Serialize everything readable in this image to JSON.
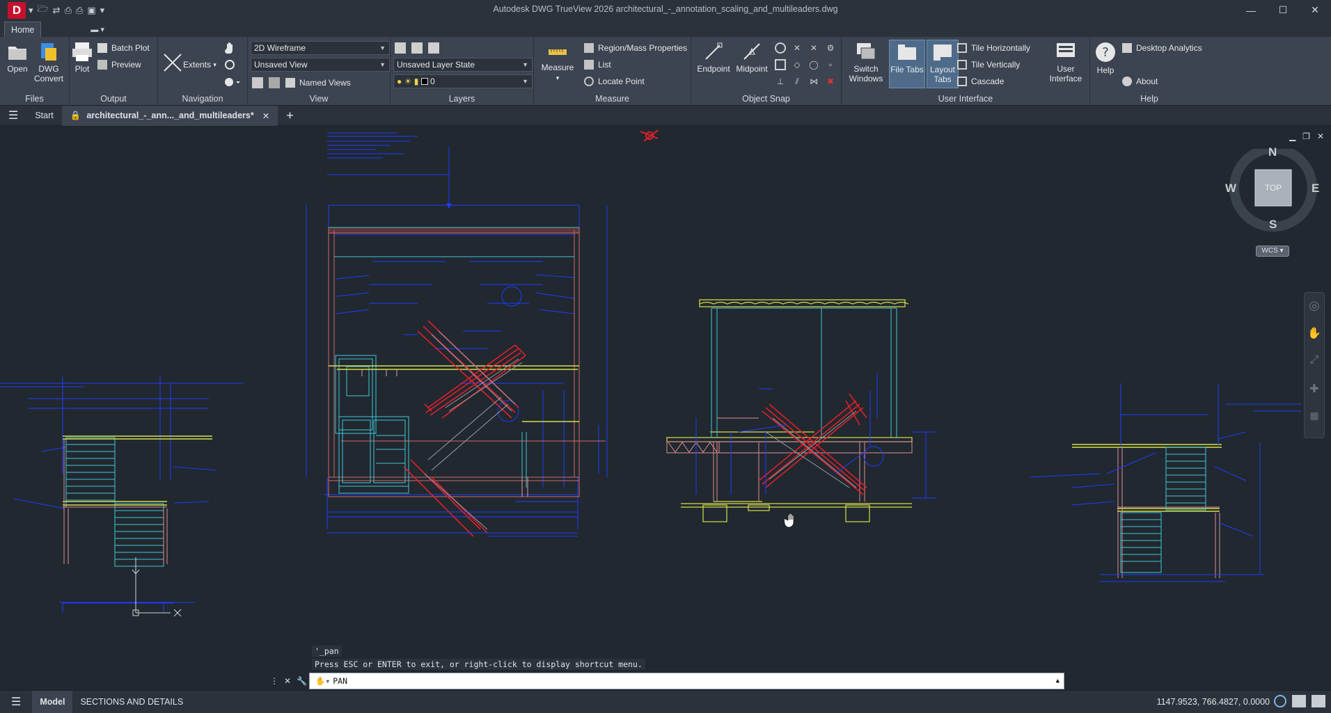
{
  "window": {
    "app_letter": "D",
    "title": "Autodesk DWG TrueView 2026    architectural_-_annotation_scaling_and_multileaders.dwg"
  },
  "ribbon": {
    "tab_home": "Home",
    "panels": {
      "files": {
        "title": "Files",
        "open": "Open",
        "dwg_convert_1": "DWG",
        "dwg_convert_2": "Convert"
      },
      "output": {
        "title": "Output",
        "plot": "Plot",
        "batch_plot": "Batch Plot",
        "preview": "Preview"
      },
      "navigation": {
        "title": "Navigation",
        "extents": "Extents"
      },
      "view": {
        "title": "View",
        "visual_style": "2D Wireframe",
        "saved_view": "Unsaved View",
        "named_views": "Named Views"
      },
      "layers": {
        "title": "Layers",
        "layer_state": "Unsaved Layer State",
        "current_layer": "0"
      },
      "measure": {
        "title": "Measure",
        "measure": "Measure",
        "region_mass": "Region/Mass Properties",
        "list": "List",
        "locate_point": "Locate Point"
      },
      "object_snap": {
        "title": "Object Snap",
        "endpoint": "Endpoint",
        "midpoint": "Midpoint"
      },
      "user_interface": {
        "title": "User Interface",
        "switch_windows_1": "Switch",
        "switch_windows_2": "Windows",
        "file_tabs_1": "File Tabs",
        "layout_tabs_1": "Layout",
        "layout_tabs_2": "Tabs",
        "tile_h": "Tile Horizontally",
        "tile_v": "Tile Vertically",
        "cascade": "Cascade",
        "user_interface_1": "User",
        "user_interface_2": "Interface"
      },
      "help": {
        "title": "Help",
        "help": "Help",
        "desktop_analytics": "Desktop Analytics",
        "about": "About"
      }
    }
  },
  "file_tabs": {
    "start": "Start",
    "current": "architectural_-_ann..._and_multileaders*"
  },
  "viewcube": {
    "n": "N",
    "s": "S",
    "e": "E",
    "w": "W",
    "face": "TOP",
    "wcs": "WCS"
  },
  "command": {
    "history_1": "'_pan",
    "history_2": "Press ESC or ENTER to exit, or right-click to display shortcut menu.",
    "input": "PAN"
  },
  "status": {
    "model_tab": "Model",
    "layout_tab": "SECTIONS AND DETAILS",
    "coordinates": "1147.9523, 766.4827, 0.0000"
  },
  "colors": {
    "canvas": "#212830",
    "ribbon": "#3b4450",
    "blue_lines": "#1f3cff",
    "red_lines": "#e0202a",
    "cyan_lines": "#3ec7d8",
    "yellow_lines": "#d8e04a",
    "green_lines": "#a9e060"
  }
}
